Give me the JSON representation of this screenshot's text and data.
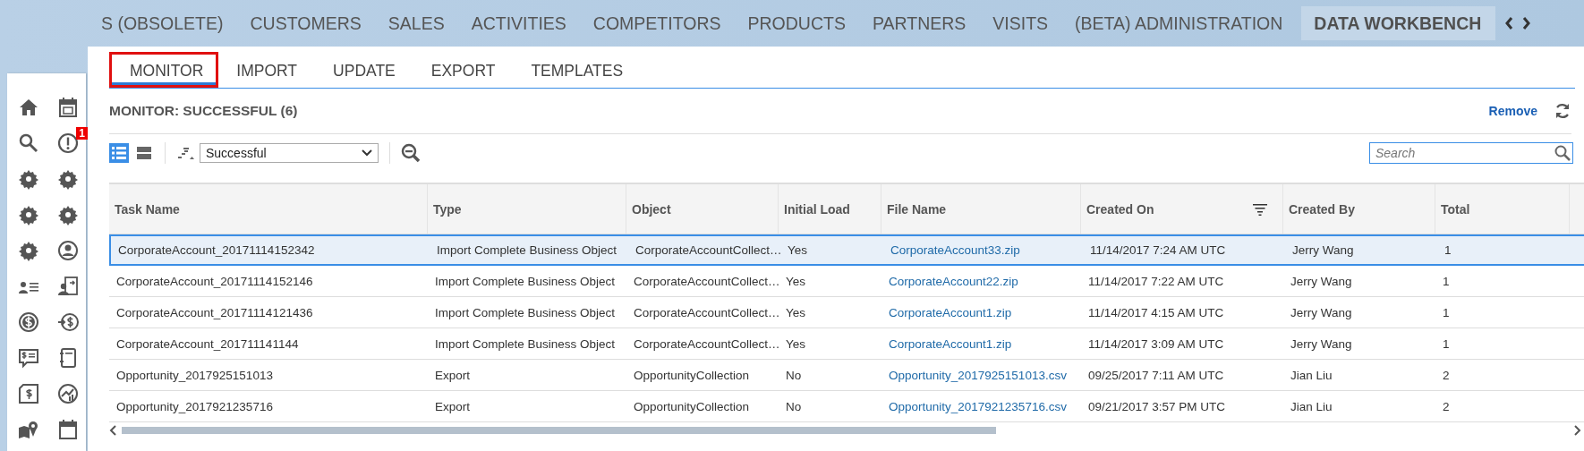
{
  "top_nav": {
    "items": [
      {
        "label": "S (OBSOLETE)",
        "selected": false
      },
      {
        "label": "CUSTOMERS",
        "selected": false
      },
      {
        "label": "SALES",
        "selected": false
      },
      {
        "label": "ACTIVITIES",
        "selected": false
      },
      {
        "label": "COMPETITORS",
        "selected": false
      },
      {
        "label": "PRODUCTS",
        "selected": false
      },
      {
        "label": "PARTNERS",
        "selected": false
      },
      {
        "label": "VISITS",
        "selected": false
      },
      {
        "label": "(BETA) ADMINISTRATION",
        "selected": false
      },
      {
        "label": "DATA WORKBENCH",
        "selected": true
      }
    ]
  },
  "sidebar": {
    "items": [
      {
        "kind": "home"
      },
      {
        "kind": "calendar"
      },
      {
        "kind": "search"
      },
      {
        "kind": "alert",
        "badge": "1"
      },
      {
        "kind": "gear"
      },
      {
        "kind": "gear"
      },
      {
        "kind": "gear"
      },
      {
        "kind": "gear"
      },
      {
        "kind": "gear"
      },
      {
        "kind": "user"
      },
      {
        "kind": "contacts"
      },
      {
        "kind": "contact-arrow"
      },
      {
        "kind": "dollar"
      },
      {
        "kind": "arrow-dollar"
      },
      {
        "kind": "dollar-speech"
      },
      {
        "kind": "notebook"
      },
      {
        "kind": "dollar-doc"
      },
      {
        "kind": "growth"
      },
      {
        "kind": "map"
      },
      {
        "kind": "calendar-blank"
      }
    ]
  },
  "tabs": [
    {
      "label": "MONITOR",
      "selected": true,
      "outlined": true
    },
    {
      "label": "IMPORT",
      "selected": false,
      "outlined": false
    },
    {
      "label": "UPDATE",
      "selected": false,
      "outlined": false
    },
    {
      "label": "EXPORT",
      "selected": false,
      "outlined": false
    },
    {
      "label": "TEMPLATES",
      "selected": false,
      "outlined": false
    }
  ],
  "heading": "MONITOR: SUCCESSFUL (6)",
  "remove_link": "Remove",
  "view_buttons": [
    {
      "kind": "list",
      "selected": true
    },
    {
      "kind": "table",
      "selected": false
    }
  ],
  "status_filter": {
    "value": "Successful"
  },
  "search": {
    "placeholder": "Search"
  },
  "table": {
    "columns": [
      {
        "label": "Task Name",
        "filtered": false,
        "kind": "text"
      },
      {
        "label": "Type",
        "filtered": false,
        "kind": "text"
      },
      {
        "label": "Object",
        "filtered": false,
        "kind": "text"
      },
      {
        "label": "Initial Load",
        "filtered": false,
        "kind": "text"
      },
      {
        "label": "File Name",
        "filtered": false,
        "kind": "link"
      },
      {
        "label": "Created On",
        "filtered": true,
        "kind": "text"
      },
      {
        "label": "Created By",
        "filtered": false,
        "kind": "text"
      },
      {
        "label": "Total",
        "filtered": false,
        "kind": "text"
      }
    ],
    "rows": [
      {
        "selected": true,
        "cells": [
          "CorporateAccount_20171114152342",
          "Import Complete Business Object",
          "CorporateAccountCollect…",
          "Yes",
          "CorporateAccount33.zip",
          "11/14/2017 7:24 AM UTC",
          "Jerry Wang",
          "1"
        ]
      },
      {
        "selected": false,
        "cells": [
          "CorporateAccount_20171114152146",
          "Import Complete Business Object",
          "CorporateAccountCollect…",
          "Yes",
          "CorporateAccount22.zip",
          "11/14/2017 7:22 AM UTC",
          "Jerry Wang",
          "1"
        ]
      },
      {
        "selected": false,
        "cells": [
          "CorporateAccount_20171114121436",
          "Import Complete Business Object",
          "CorporateAccountCollect…",
          "Yes",
          "CorporateAccount1.zip",
          "11/14/2017 4:15 AM UTC",
          "Jerry Wang",
          "1"
        ]
      },
      {
        "selected": false,
        "cells": [
          "CorporateAccount_201711141144",
          "Import Complete Business Object",
          "CorporateAccountCollect…",
          "Yes",
          "CorporateAccount1.zip",
          "11/14/2017 3:09 AM UTC",
          "Jerry Wang",
          "1"
        ]
      },
      {
        "selected": false,
        "cells": [
          "Opportunity_2017925151013",
          "Export",
          "OpportunityCollection",
          "No",
          "Opportunity_2017925151013.csv",
          "09/25/2017 7:11 AM UTC",
          "Jian Liu",
          "2"
        ]
      },
      {
        "selected": false,
        "cells": [
          "Opportunity_2017921235716",
          "Export",
          "OpportunityCollection",
          "No",
          "Opportunity_2017921235716.csv",
          "09/21/2017 3:57 PM UTC",
          "Jian Liu",
          "2"
        ]
      }
    ]
  }
}
